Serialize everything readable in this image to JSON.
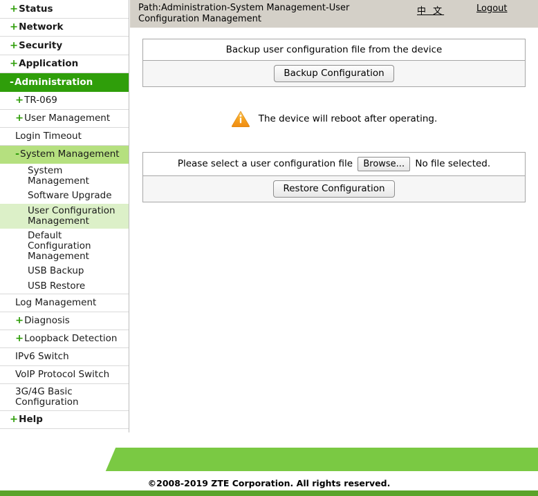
{
  "header": {
    "breadcrumb": "Path:Administration-System Management-User Configuration Management",
    "lang_label": "中 文",
    "logout_label": "Logout"
  },
  "sidebar": {
    "top_items": [
      {
        "label": "Status",
        "icon": "plus-icon",
        "prefix": "+"
      },
      {
        "label": "Network",
        "icon": "plus-icon",
        "prefix": "+"
      },
      {
        "label": "Security",
        "icon": "plus-icon",
        "prefix": "+"
      },
      {
        "label": "Application",
        "icon": "plus-icon",
        "prefix": "+"
      },
      {
        "label": "Administration",
        "icon": "minus-icon",
        "prefix": "-",
        "active": true
      }
    ],
    "admin_children": [
      {
        "label": "TR-069",
        "prefix": "+"
      },
      {
        "label": "User Management",
        "prefix": "+"
      },
      {
        "label": "Login Timeout",
        "prefix": ""
      },
      {
        "label": "System Management",
        "prefix": "-",
        "open": true
      }
    ],
    "system_children": [
      {
        "label": "System Management"
      },
      {
        "label": "Software Upgrade"
      },
      {
        "label": "User Configuration Management",
        "selected": true
      },
      {
        "label": "Default Configuration Management"
      },
      {
        "label": "USB Backup"
      },
      {
        "label": "USB Restore"
      }
    ],
    "admin_children_rest": [
      {
        "label": "Log Management",
        "prefix": ""
      },
      {
        "label": "Diagnosis",
        "prefix": "+"
      },
      {
        "label": "Loopback Detection",
        "prefix": "+"
      },
      {
        "label": "IPv6 Switch",
        "prefix": ""
      },
      {
        "label": "VoIP Protocol Switch",
        "prefix": ""
      },
      {
        "label": "3G/4G Basic Configuration",
        "prefix": ""
      }
    ],
    "help_item": {
      "label": "Help",
      "prefix": "+"
    },
    "help_badge": "?"
  },
  "main": {
    "backup": {
      "title": "Backup user configuration file from the device",
      "button_label": "Backup Configuration"
    },
    "notice": {
      "text": "The device will reboot after operating.",
      "icon": "warning-triangle-icon"
    },
    "restore": {
      "file_label": "Please select a user configuration file",
      "browse_label": "Browse...",
      "file_status": "No file selected.",
      "button_label": "Restore Configuration"
    }
  },
  "footer": {
    "copyright": "©2008-2019 ZTE Corporation. All rights reserved."
  },
  "colors": {
    "brand_green": "#2f9e0a",
    "banner_green": "#7ac943",
    "bottom_bar_green": "#5aa32a",
    "submenu_open": "#b5e07f",
    "submenu_selected": "#dcf0c8",
    "header_gray": "#d4d0c8",
    "warning_orange": "#f5a623"
  }
}
